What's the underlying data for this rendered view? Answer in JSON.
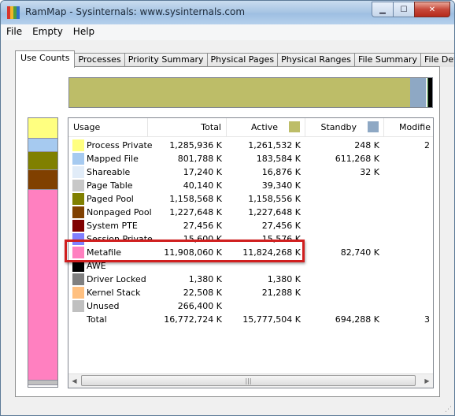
{
  "window": {
    "title": "RamMap - Sysinternals: www.sysinternals.com",
    "icon_colors": [
      "#d7352c",
      "#f1b529",
      "#4f9e3a",
      "#2f6fc8"
    ]
  },
  "menu": [
    "File",
    "Empty",
    "Help"
  ],
  "tabs": [
    "Use Counts",
    "Processes",
    "Priority Summary",
    "Physical Pages",
    "Physical Ranges",
    "File Summary",
    "File Details"
  ],
  "active_tab": "Use Counts",
  "columns": {
    "usage": "Usage",
    "total": "Total",
    "active": "Active",
    "standby": "Standby",
    "modified": "Modifie"
  },
  "column_colors": {
    "active": "#bdbd68",
    "standby": "#8ea8c4"
  },
  "rows": [
    {
      "label": "Process Private",
      "total": "1,285,936 K",
      "active": "1,261,532 K",
      "standby": "248 K",
      "modified": "2",
      "color": "#ffff80"
    },
    {
      "label": "Mapped File",
      "total": "801,788 K",
      "active": "183,584 K",
      "standby": "611,268 K",
      "modified": "",
      "color": "#a6caf0"
    },
    {
      "label": "Shareable",
      "total": "17,240 K",
      "active": "16,876 K",
      "standby": "32 K",
      "modified": "",
      "color": "#e1ecf8"
    },
    {
      "label": "Page Table",
      "total": "40,140 K",
      "active": "39,340 K",
      "standby": "",
      "modified": "",
      "color": "#c8c8c8"
    },
    {
      "label": "Paged Pool",
      "total": "1,158,568 K",
      "active": "1,158,556 K",
      "standby": "",
      "modified": "",
      "color": "#808000"
    },
    {
      "label": "Nonpaged Pool",
      "total": "1,227,648 K",
      "active": "1,227,648 K",
      "standby": "",
      "modified": "",
      "color": "#804000"
    },
    {
      "label": "System PTE",
      "total": "27,456 K",
      "active": "27,456 K",
      "standby": "",
      "modified": "",
      "color": "#800000"
    },
    {
      "label": "Session Private",
      "total": "15,600 K",
      "active": "15,576 K",
      "standby": "",
      "modified": "",
      "color": "#8080ff"
    },
    {
      "label": "Metafile",
      "total": "11,908,060 K",
      "active": "11,824,268 K",
      "standby": "82,740 K",
      "modified": "",
      "color": "#ff80c0"
    },
    {
      "label": "AWE",
      "total": "",
      "active": "",
      "standby": "",
      "modified": "",
      "color": "#000000"
    },
    {
      "label": "Driver Locked",
      "total": "1,380 K",
      "active": "1,380 K",
      "standby": "",
      "modified": "",
      "color": "#808080"
    },
    {
      "label": "Kernel Stack",
      "total": "22,508 K",
      "active": "21,288 K",
      "standby": "",
      "modified": "",
      "color": "#ffc080"
    },
    {
      "label": "Unused",
      "total": "266,400 K",
      "active": "",
      "standby": "",
      "modified": "",
      "color": "#c0c0c0"
    },
    {
      "label": "Total",
      "total": "16,772,724 K",
      "active": "15,777,504 K",
      "standby": "694,288 K",
      "modified": "3",
      "color": ""
    }
  ],
  "horizontal_bar": [
    {
      "name": "Active",
      "fraction": 0.94,
      "color": "#bdbd68"
    },
    {
      "name": "Standby",
      "fraction": 0.042,
      "color": "#8ea8c4"
    },
    {
      "name": "Modified",
      "fraction": 0.006,
      "color": "#f0f0f0"
    },
    {
      "name": "Transition",
      "fraction": 0.002,
      "color": "#3c8c3c"
    },
    {
      "name": "Free",
      "fraction": 0.01,
      "color": "#000000"
    }
  ],
  "vertical_bar": [
    {
      "name": "Process Private",
      "fraction": 0.077,
      "color": "#ffff80"
    },
    {
      "name": "Mapped File",
      "fraction": 0.048,
      "color": "#a6caf0"
    },
    {
      "name": "Paged Pool",
      "fraction": 0.069,
      "color": "#808000"
    },
    {
      "name": "Nonpaged Pool",
      "fraction": 0.073,
      "color": "#804000"
    },
    {
      "name": "Metafile",
      "fraction": 0.71,
      "color": "#ff80c0"
    },
    {
      "name": "Unused",
      "fraction": 0.016,
      "color": "#c0c0c0"
    }
  ],
  "highlighted_row": "Metafile"
}
